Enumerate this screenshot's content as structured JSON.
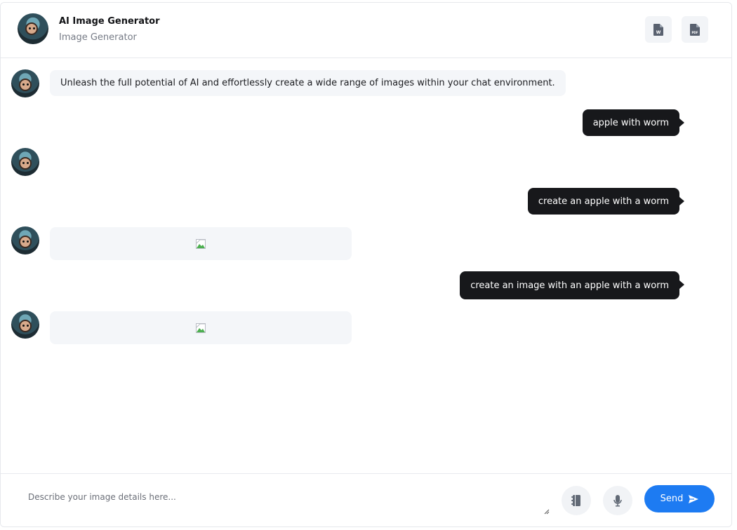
{
  "header": {
    "title": "AI Image Generator",
    "subtitle": "Image Generator",
    "export_word_icon": "word-document-icon",
    "export_pdf_icon": "pdf-document-icon"
  },
  "messages": [
    {
      "role": "bot",
      "text": "Unleash the full potential of AI and effortlessly create a wide range of images within your chat environment."
    },
    {
      "role": "user",
      "text": "apple with worm"
    },
    {
      "role": "bot",
      "text": ""
    },
    {
      "role": "user",
      "text": "create an apple with a worm"
    },
    {
      "role": "bot",
      "image": "broken-image-icon"
    },
    {
      "role": "user",
      "text": "create an image with an apple with a worm"
    },
    {
      "role": "bot",
      "image": "broken-image-icon"
    }
  ],
  "composer": {
    "placeholder": "Describe your image details here...",
    "value": "",
    "notebook_icon": "notebook-icon",
    "mic_icon": "microphone-icon",
    "send_label": "Send",
    "send_icon": "send-arrow-icon"
  },
  "colors": {
    "accent": "#1d7bf2",
    "user_bubble": "#17181b",
    "bot_bubble": "#f4f6f9"
  }
}
